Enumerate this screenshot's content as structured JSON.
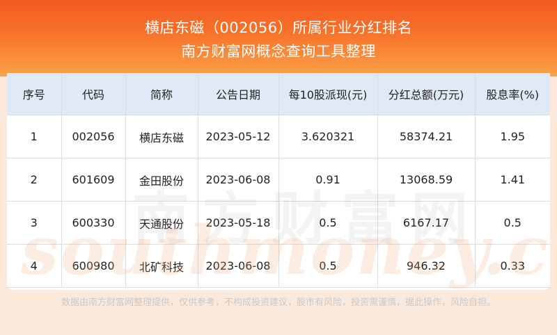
{
  "header": {
    "title_line1": "横店东磁（002056）所属行业分红排名",
    "title_line2": "南方财富网概念查询工具整理"
  },
  "table": {
    "columns": [
      "序号",
      "代码",
      "简称",
      "公告日期",
      "每10股派现(元)",
      "分红总额(万元)",
      "股息率(%)"
    ],
    "rows": [
      [
        "1",
        "002056",
        "横店东磁",
        "2023-05-12",
        "3.620321",
        "58374.21",
        "1.95"
      ],
      [
        "2",
        "601609",
        "金田股份",
        "2023-06-08",
        "0.91",
        "13068.59",
        "1.41"
      ],
      [
        "3",
        "600330",
        "天通股份",
        "2023-05-18",
        "0.5",
        "6167.17",
        "0.5"
      ],
      [
        "4",
        "600980",
        "北矿科技",
        "2023-06-08",
        "0.5",
        "946.32",
        "0.33"
      ]
    ]
  },
  "watermark": {
    "cn": "南方财富网",
    "en": "southmoney.com"
  },
  "footer": {
    "disclaimer": "数据由南方财富网整理提供，仅供参考，不构成投资建议，股市有风险，投资需谨慎，据此操作，风险自担。"
  },
  "colors": {
    "header_top": "#f45a22",
    "header_bottom": "#fba24a",
    "table_header_bg": "#dfeaf6",
    "page_bg": "#fbe9dc"
  }
}
